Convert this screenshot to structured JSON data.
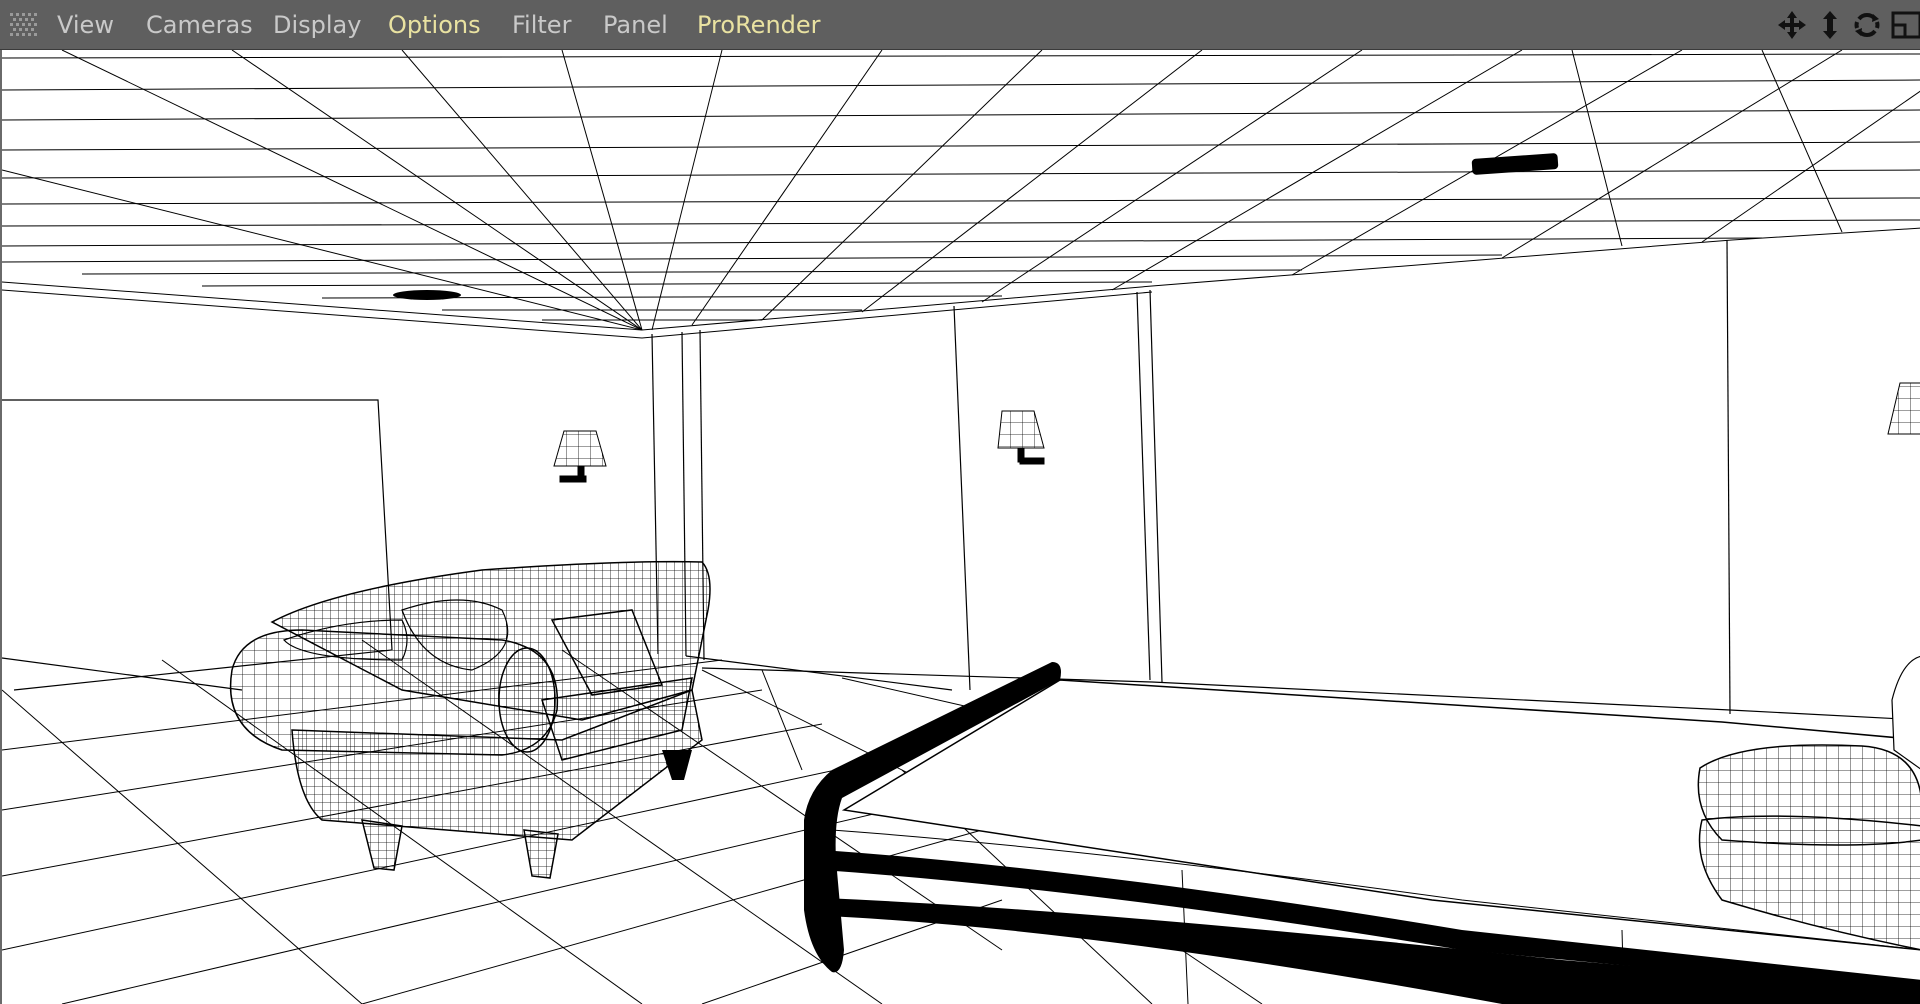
{
  "menu": {
    "items": [
      {
        "label": "View",
        "active": false
      },
      {
        "label": "Cameras",
        "active": false
      },
      {
        "label": "Display",
        "active": false
      },
      {
        "label": "Options",
        "active": true
      },
      {
        "label": "Filter",
        "active": false
      },
      {
        "label": "Panel",
        "active": false
      },
      {
        "label": "ProRender",
        "active": true
      }
    ]
  },
  "nav_icons": [
    "move-icon",
    "dolly-icon",
    "rotate-icon",
    "toggle-view-icon"
  ],
  "colors": {
    "menubar": "#5f5f5f",
    "menu_text": "#c9c9c9",
    "menu_text_active": "#e9e2a1",
    "wireframe": "#000000",
    "background": "#ffffff"
  }
}
